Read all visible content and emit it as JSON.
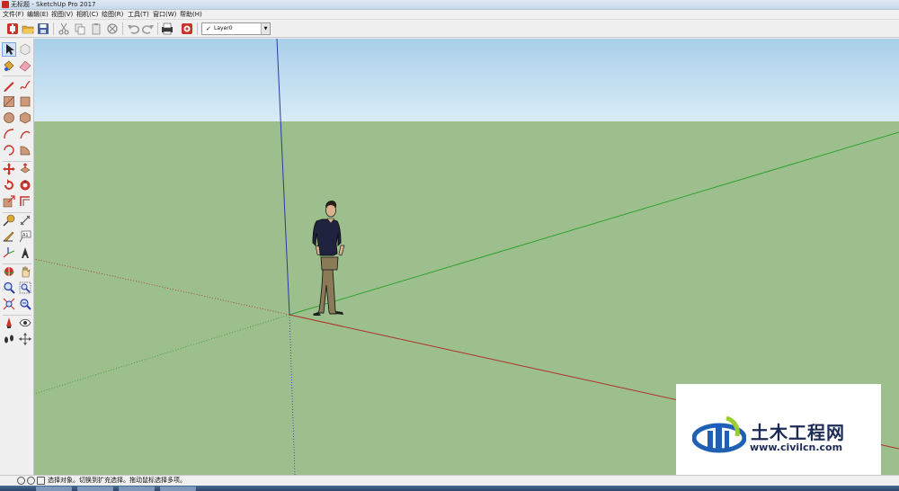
{
  "window": {
    "title": "无标题 - SketchUp Pro 2017"
  },
  "menu": {
    "items": [
      "文件(F)",
      "编辑(E)",
      "视图(V)",
      "相机(C)",
      "绘图(R)",
      "工具(T)",
      "窗口(W)",
      "帮助(H)"
    ]
  },
  "toolbar": {
    "buttons": [
      "getting-started",
      "open",
      "save",
      "cut",
      "copy",
      "paste",
      "erase",
      "undo",
      "redo",
      "print",
      "model-info"
    ],
    "layer": {
      "check": "✓",
      "value": "Layer0"
    }
  },
  "tools": [
    "select",
    "make-component",
    "paint-bucket",
    "eraser",
    "line",
    "freehand",
    "rectangle",
    "rotated-rectangle",
    "circle",
    "polygon",
    "arc",
    "two-point-arc",
    "three-point-arc",
    "pie",
    "move",
    "push-pull",
    "rotate",
    "follow-me",
    "scale",
    "offset",
    "tape-measure",
    "dimensions",
    "protractor",
    "text",
    "axes",
    "3d-text",
    "orbit",
    "pan",
    "zoom",
    "zoom-window",
    "zoom-extents",
    "previous-view",
    "position-camera",
    "look-around",
    "walk",
    "section-plane"
  ],
  "status": {
    "text": "选择对象。切换到扩充选择。拖动鼠标选择多项。"
  },
  "watermark": {
    "brand": "土木工程网",
    "url": "www.civilcn.com"
  },
  "colors": {
    "sky": "#bcdcf0",
    "ground": "#9dbf8e",
    "red_axis": "#b0302a",
    "green_axis": "#2da12d",
    "blue_axis": "#2a3aa8"
  }
}
